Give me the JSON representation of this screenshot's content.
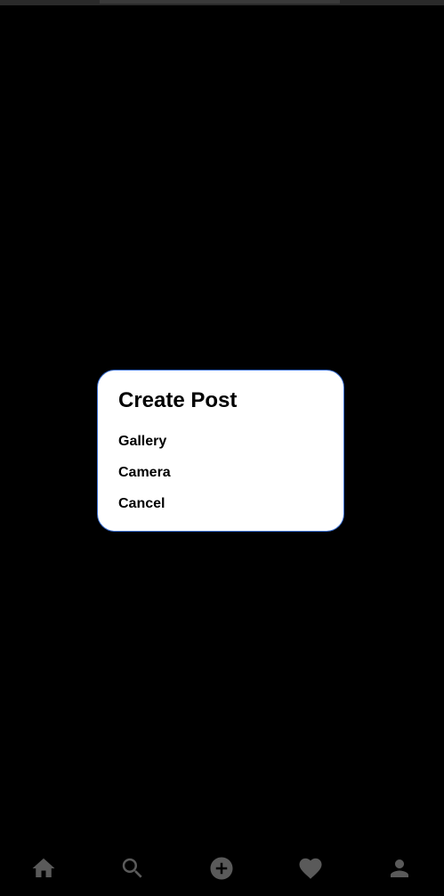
{
  "dialog": {
    "title": "Create Post",
    "options": [
      {
        "label": "Gallery"
      },
      {
        "label": "Camera"
      },
      {
        "label": "Cancel"
      }
    ]
  },
  "bottom_nav": {
    "items": [
      {
        "icon": "home-icon"
      },
      {
        "icon": "search-icon"
      },
      {
        "icon": "add-circle-icon"
      },
      {
        "icon": "heart-icon"
      },
      {
        "icon": "person-icon"
      }
    ]
  },
  "colors": {
    "background": "#000000",
    "dialog_background": "#ffffff",
    "dialog_border": "#3b6fd1",
    "nav_icon": "#5a5a5a"
  }
}
